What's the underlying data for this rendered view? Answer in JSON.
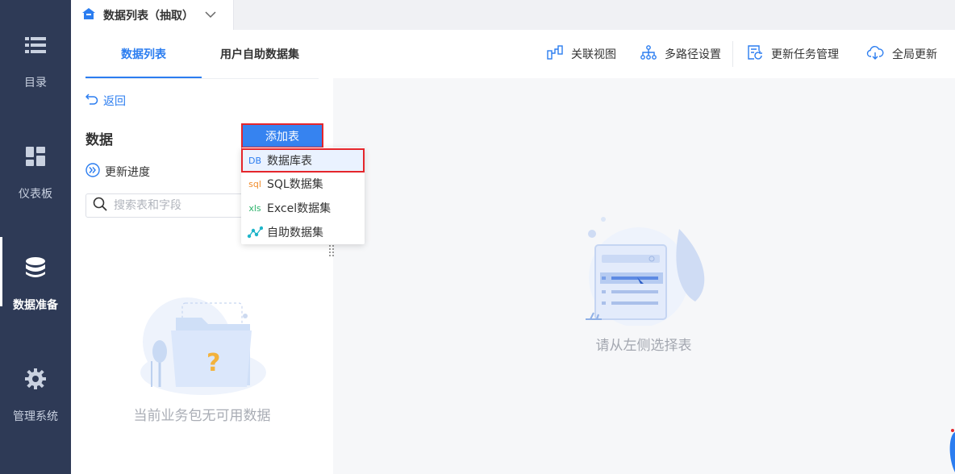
{
  "nav": {
    "items": [
      {
        "label": "目录",
        "icon": "list-icon"
      },
      {
        "label": "仪表板",
        "icon": "dashboard-icon"
      },
      {
        "label": "数据准备",
        "icon": "database-icon"
      },
      {
        "label": "管理系统",
        "icon": "gear-icon"
      }
    ],
    "active_index": 2
  },
  "doc_tab": {
    "title": "数据列表（抽取）"
  },
  "subtabs": [
    {
      "label": "数据列表"
    },
    {
      "label": "用户自助数据集"
    }
  ],
  "toolbar": {
    "relation_view": "关联视图",
    "multipath": "多路径设置",
    "update_task": "更新任务管理",
    "global_update": "全局更新"
  },
  "panel": {
    "back": "返回",
    "title": "数据",
    "progress": "更新进度",
    "search_placeholder": "搜索表和字段",
    "empty_text": "当前业务包无可用数据"
  },
  "add_table": {
    "label": "添加表",
    "menu": [
      {
        "icon_text": "DB",
        "label": "数据库表",
        "color": "#2b7df0"
      },
      {
        "icon_text": "sql",
        "label": "SQL数据集",
        "color": "#f08c2b"
      },
      {
        "icon_text": "xls",
        "label": "Excel数据集",
        "color": "#2bb36a"
      },
      {
        "icon_text": "",
        "label": "自助数据集",
        "color": "#1fb5c9"
      }
    ]
  },
  "main": {
    "empty_text": "请从左侧选择表"
  },
  "colors": {
    "accent": "#2b7df0",
    "nav_bg": "#2e3a56",
    "highlight": "#e5262c"
  }
}
